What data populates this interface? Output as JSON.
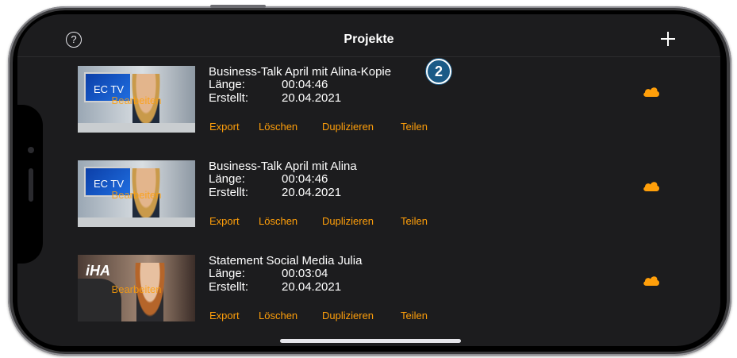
{
  "header": {
    "title": "Projekte",
    "help_icon": "question-circle-icon",
    "add_icon": "plus-icon"
  },
  "projects": [
    {
      "name": "Business-Talk April mit Alina-Kopie",
      "length_label": "Länge:",
      "length": "00:04:46",
      "created_label": "Erstellt:",
      "created": "20.04.2021",
      "thumb_logo": "EC TV",
      "thumb_overlay": "Bearbeiten",
      "actions": {
        "export": "Export",
        "delete": "Löschen",
        "duplicate": "Duplizieren",
        "share": "Teilen"
      },
      "cloud_icon": "cloud-icon"
    },
    {
      "name": "Business-Talk April mit Alina",
      "length_label": "Länge:",
      "length": "00:04:46",
      "created_label": "Erstellt:",
      "created": "20.04.2021",
      "thumb_logo": "EC TV",
      "thumb_overlay": "Bearbeiten",
      "actions": {
        "export": "Export",
        "delete": "Löschen",
        "duplicate": "Duplizieren",
        "share": "Teilen"
      },
      "cloud_icon": "cloud-icon"
    },
    {
      "name": "Statement Social Media Julia",
      "length_label": "Länge:",
      "length": "00:03:04",
      "created_label": "Erstellt:",
      "created": "20.04.2021",
      "thumb_logo": "iHA",
      "thumb_overlay": "Bearbeiten",
      "actions": {
        "export": "Export",
        "delete": "Löschen",
        "duplicate": "Duplizieren",
        "share": "Teilen"
      },
      "cloud_icon": "cloud-icon"
    }
  ],
  "callout": {
    "number": "2"
  },
  "colors": {
    "accent": "#ff9f0a",
    "background": "#1c1c1e",
    "badge": "#1a5a86"
  }
}
